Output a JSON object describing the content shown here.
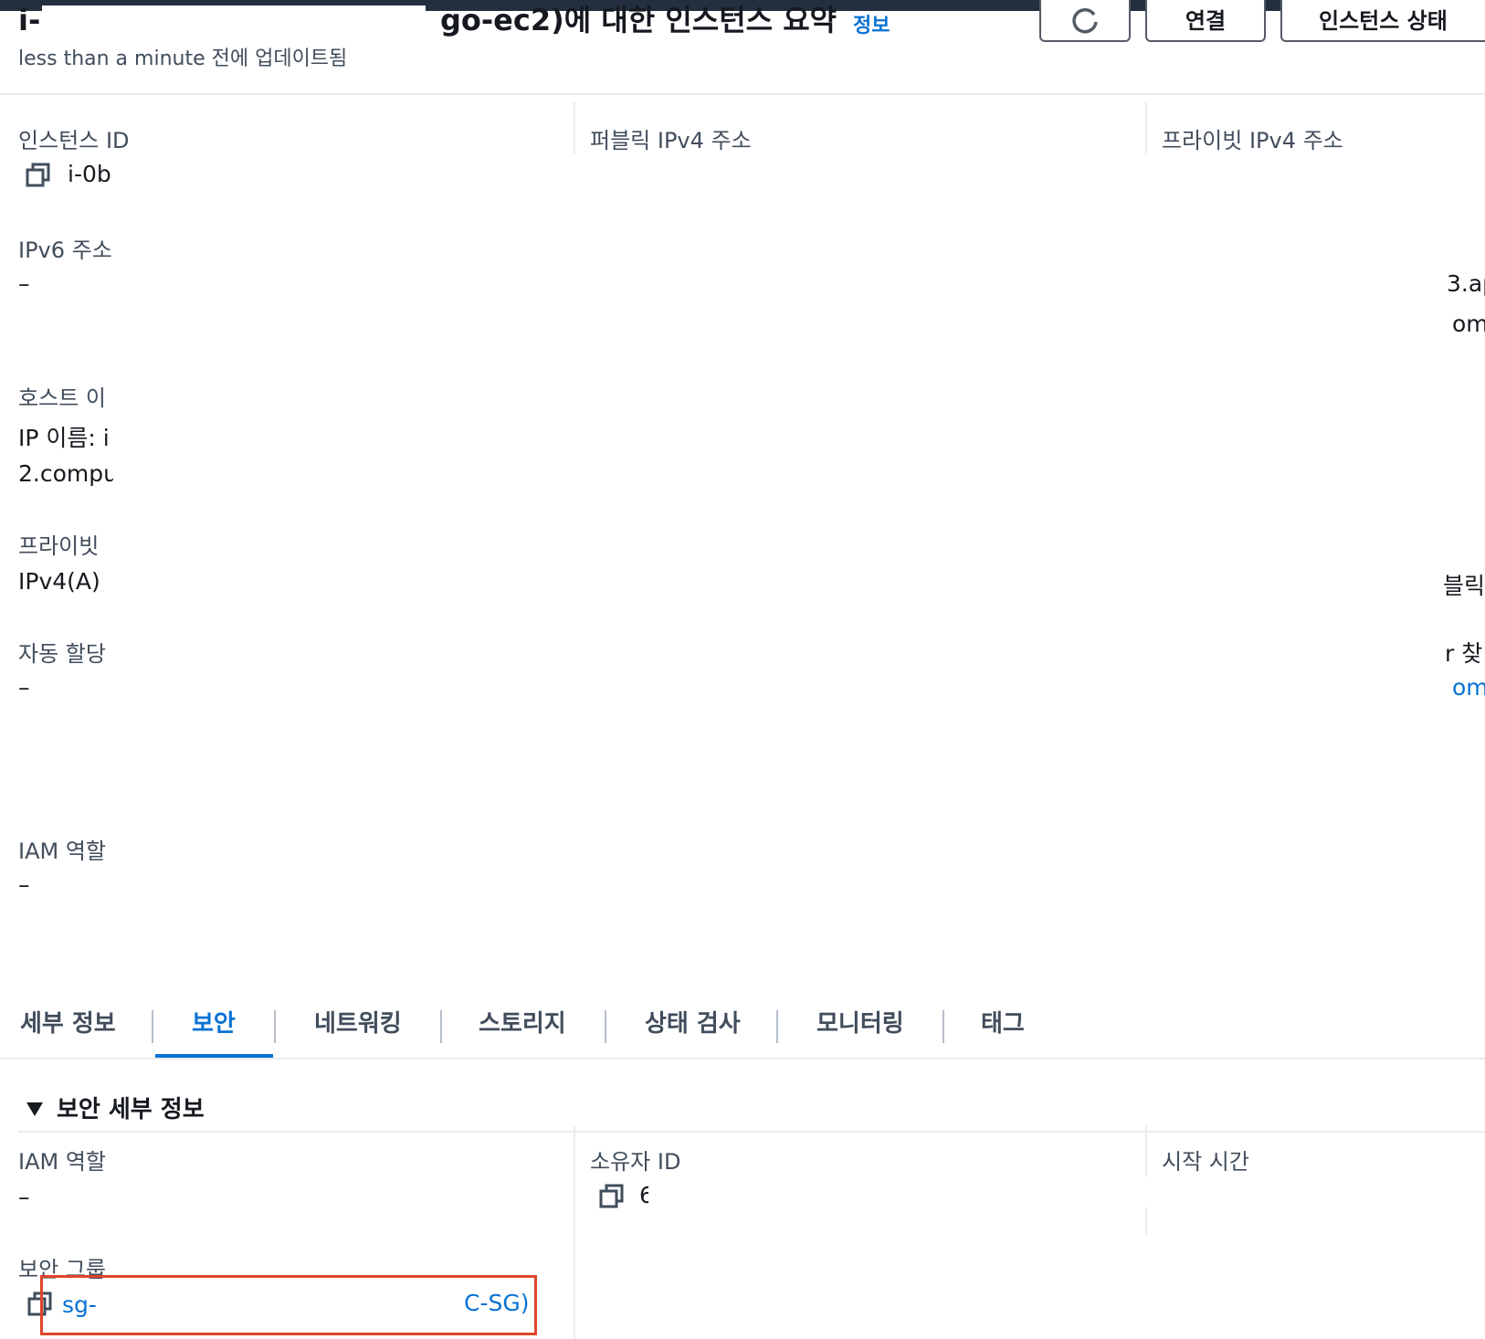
{
  "header": {
    "title_left": "i-(",
    "title_right": "go-ec2)에 대한 인스턴스 요약",
    "info_link": "정보",
    "updated": "less than a minute 전에 업데이트됨",
    "buttons": {
      "connect": "연결",
      "instance_state": "인스턴스 상태"
    }
  },
  "summary": {
    "col1": {
      "instance_id_label": "인스턴스 ID",
      "instance_id_value": "i-0b",
      "ipv6_label": "IPv6 주소",
      "ipv6_value": "–",
      "hostname_label": "호스트 이",
      "hostname_value_1": "IP 이름: i",
      "hostname_value_2": "2.compu",
      "private_label": "프라이빗",
      "private_value": "IPv4(A)",
      "auto_label": "자동 할당",
      "auto_value": "–",
      "iam_label": "IAM 역할",
      "iam_value": "–"
    },
    "col2": {
      "public_ipv4_label": "퍼블릭 IPv4 주소"
    },
    "col3": {
      "private_ipv4_label": "프라이빗 IPv4 주소",
      "frag_1": "3.ap",
      "frag_2": "om",
      "frag_3": "블릭",
      "frag_4": "r 찾",
      "frag_5": "om"
    }
  },
  "tabs": [
    {
      "label": "세부 정보"
    },
    {
      "label": "보안"
    },
    {
      "label": "네트워킹"
    },
    {
      "label": "스토리지"
    },
    {
      "label": "상태 검사"
    },
    {
      "label": "모니터링"
    },
    {
      "label": "태그"
    }
  ],
  "active_tab": "보안",
  "security": {
    "section_title": "보안 세부 정보",
    "iam_label": "IAM 역할",
    "iam_value": "–",
    "owner_label": "소유자 ID",
    "owner_value": "6",
    "launch_label": "시작 시간",
    "sg_label": "보안 그룹",
    "sg_value_start": "sg-",
    "sg_value_end": "C-SG)"
  },
  "colors": {
    "link": "#0972d3",
    "highlight_box": "#e0452b",
    "topbar": "#232f3e"
  }
}
